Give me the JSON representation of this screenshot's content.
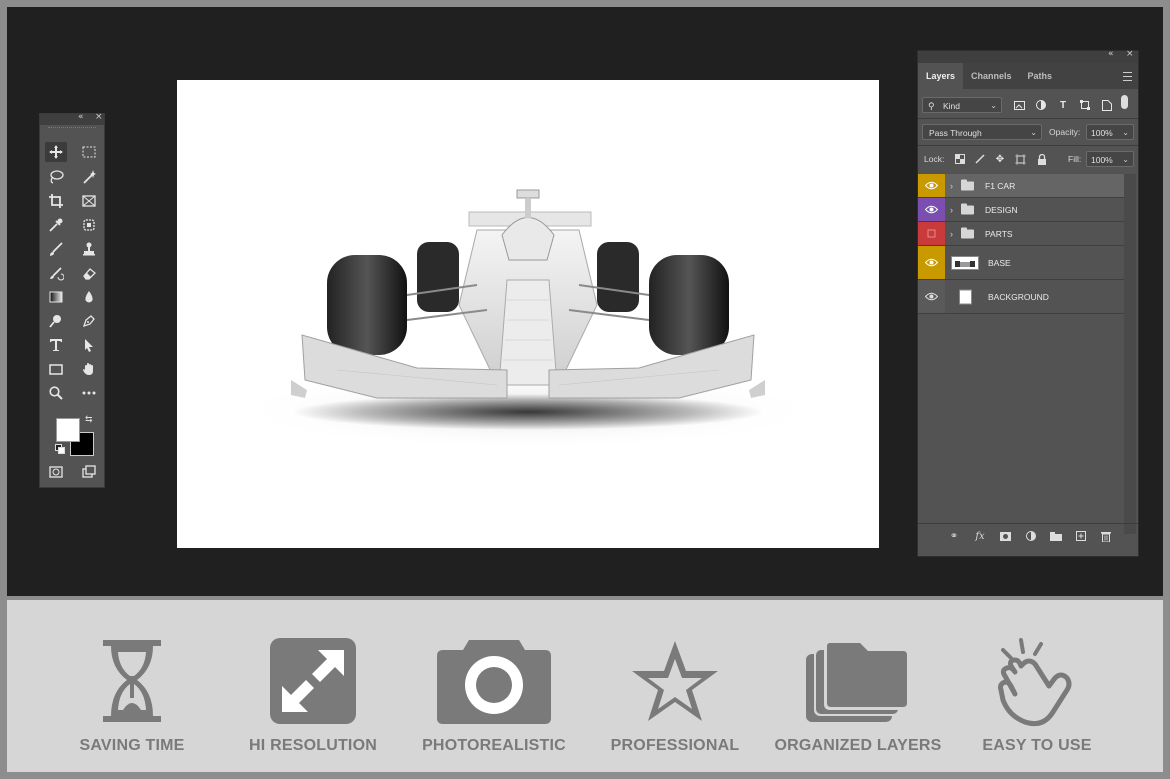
{
  "toolbox": {
    "collapse_glyph": "«",
    "close_glyph": "×",
    "tools": [
      {
        "name": "move-tool-icon"
      },
      {
        "name": "marquee-tool-icon"
      },
      {
        "name": "lasso-tool-icon"
      },
      {
        "name": "magic-wand-tool-icon"
      },
      {
        "name": "crop-tool-icon"
      },
      {
        "name": "frame-tool-icon"
      },
      {
        "name": "eyedropper-tool-icon"
      },
      {
        "name": "healing-brush-tool-icon"
      },
      {
        "name": "brush-tool-icon"
      },
      {
        "name": "clone-stamp-tool-icon"
      },
      {
        "name": "history-brush-tool-icon"
      },
      {
        "name": "eraser-tool-icon"
      },
      {
        "name": "gradient-tool-icon"
      },
      {
        "name": "blur-tool-icon"
      },
      {
        "name": "dodge-tool-icon"
      },
      {
        "name": "pen-tool-icon"
      },
      {
        "name": "type-tool-icon"
      },
      {
        "name": "path-selection-tool-icon"
      },
      {
        "name": "rectangle-tool-icon"
      },
      {
        "name": "hand-tool-icon"
      },
      {
        "name": "zoom-tool-icon"
      },
      {
        "name": "more-tools-icon"
      }
    ],
    "foreground_color": "#ffffff",
    "background_color": "#000000"
  },
  "layers_panel": {
    "collapse_glyph": "«",
    "close_glyph": "×",
    "tabs": [
      "Layers",
      "Channels",
      "Paths"
    ],
    "active_tab": "Layers",
    "filter_kind": "Kind",
    "blend_mode": "Pass Through",
    "opacity_label": "Opacity:",
    "opacity_value": "100%",
    "lock_label": "Lock:",
    "fill_label": "Fill:",
    "fill_value": "100%",
    "layers": [
      {
        "name": "F1 CAR",
        "type": "group",
        "color": "#c89a00",
        "visible": true,
        "selected": true
      },
      {
        "name": "DESIGN",
        "type": "group",
        "color": "#7b4fb0",
        "visible": true,
        "selected": false
      },
      {
        "name": "PARTS",
        "type": "group",
        "color": "#c93a3a",
        "visible": false,
        "selected": false
      },
      {
        "name": "BASE",
        "type": "smart-object",
        "color": "#c89a00",
        "visible": true,
        "selected": false
      },
      {
        "name": "BACKGROUND",
        "type": "pixel",
        "color": "#5a5a5a",
        "visible": true,
        "selected": false
      }
    ]
  },
  "features": [
    {
      "label": "SAVING TIME",
      "icon": "hourglass-icon"
    },
    {
      "label": "HI RESOLUTION",
      "icon": "expand-arrows-icon"
    },
    {
      "label": "PHOTOREALISTIC",
      "icon": "camera-icon"
    },
    {
      "label": "PROFESSIONAL",
      "icon": "star-icon"
    },
    {
      "label": "ORGANIZED LAYERS",
      "icon": "stacked-folders-icon"
    },
    {
      "label": "EASY TO USE",
      "icon": "tap-hand-icon"
    }
  ],
  "colors": {
    "workspace": "#202020",
    "panel": "#535353",
    "feature_band": "#d6d6d6",
    "feature_icon": "#7a7a7a"
  }
}
